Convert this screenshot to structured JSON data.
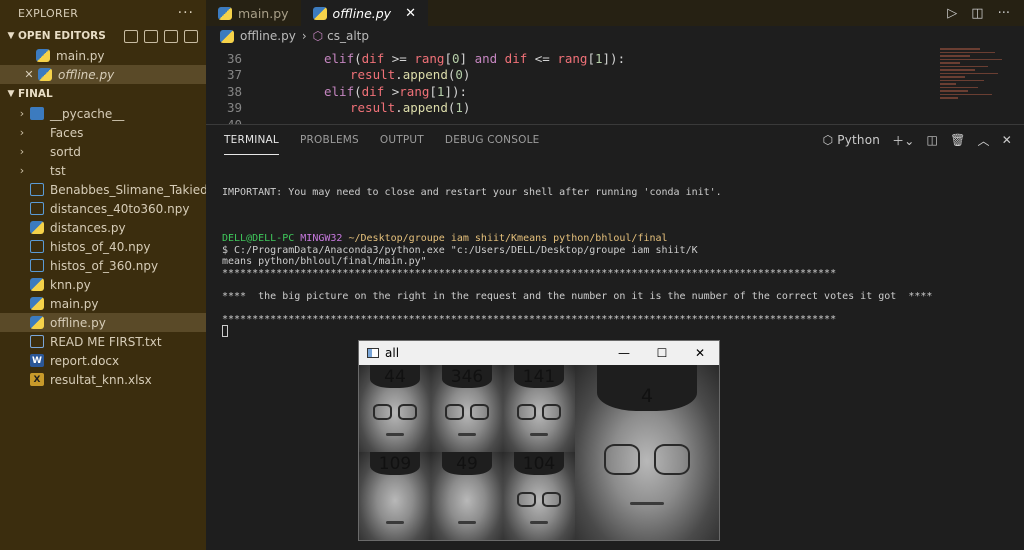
{
  "sidebar": {
    "title": "EXPLORER",
    "more": "···",
    "open_editors": {
      "label": "OPEN EDITORS",
      "items": [
        {
          "label": "main.py"
        },
        {
          "label": "offline.py"
        }
      ]
    },
    "folder": {
      "label": "FINAL",
      "items": [
        {
          "label": "__pycache__",
          "type": "folder"
        },
        {
          "label": "Faces",
          "type": "folder"
        },
        {
          "label": "sortd",
          "type": "folder"
        },
        {
          "label": "tst",
          "type": "folder"
        },
        {
          "label": "Benabbes_Slimane_Takiedine...",
          "type": "npy"
        },
        {
          "label": "distances_40to360.npy",
          "type": "npy"
        },
        {
          "label": "distances.py",
          "type": "py"
        },
        {
          "label": "histos_of_40.npy",
          "type": "npy"
        },
        {
          "label": "histos_of_360.npy",
          "type": "npy"
        },
        {
          "label": "knn.py",
          "type": "py"
        },
        {
          "label": "main.py",
          "type": "py"
        },
        {
          "label": "offline.py",
          "type": "py"
        },
        {
          "label": "READ ME FIRST.txt",
          "type": "txt"
        },
        {
          "label": "report.docx",
          "type": "docx"
        },
        {
          "label": "resultat_knn.xlsx",
          "type": "xlsx"
        }
      ]
    }
  },
  "tabs": [
    {
      "label": "main.py"
    },
    {
      "label": "offline.py"
    }
  ],
  "breadcrumb": {
    "file": "offline.py",
    "symbol": "cs_altp"
  },
  "code": {
    "lines": [
      {
        "num": "36"
      },
      {
        "num": "37"
      },
      {
        "num": "38"
      },
      {
        "num": "39"
      },
      {
        "num": "40"
      }
    ],
    "tokens": {
      "elif": "elif",
      "dif": "dif",
      "rang": "rang",
      "and": "and",
      "result": "result",
      "append": "append",
      "zero": "0",
      "one": "1"
    }
  },
  "panel": {
    "tabs": [
      "TERMINAL",
      "PROBLEMS",
      "OUTPUT",
      "DEBUG CONSOLE"
    ],
    "shell": "Python",
    "terminal": {
      "important": "IMPORTANT: You may need to close and restart your shell after running 'conda init'.",
      "user": "DELL@DELL-PC",
      "system": "MINGW32",
      "cwd": "~/Desktop/groupe iam shiit/Kmeans python/bhloul/final",
      "cmd1": "$ C:/ProgramData/Anaconda3/python.exe \"c:/Users/DELL/Desktop/groupe iam shiit/K",
      "cmd2": "means python/bhloul/final/main.py\"",
      "stars": "******************************************************************************************************",
      "message": "****  the big picture on the right in the request and the number on it is the number of the correct votes it got  ****"
    }
  },
  "window": {
    "title": "all",
    "faces": [
      {
        "label": "44"
      },
      {
        "label": "346"
      },
      {
        "label": "141"
      },
      {
        "label": "109"
      },
      {
        "label": "49"
      },
      {
        "label": "104"
      }
    ],
    "request": {
      "label": "4"
    }
  }
}
